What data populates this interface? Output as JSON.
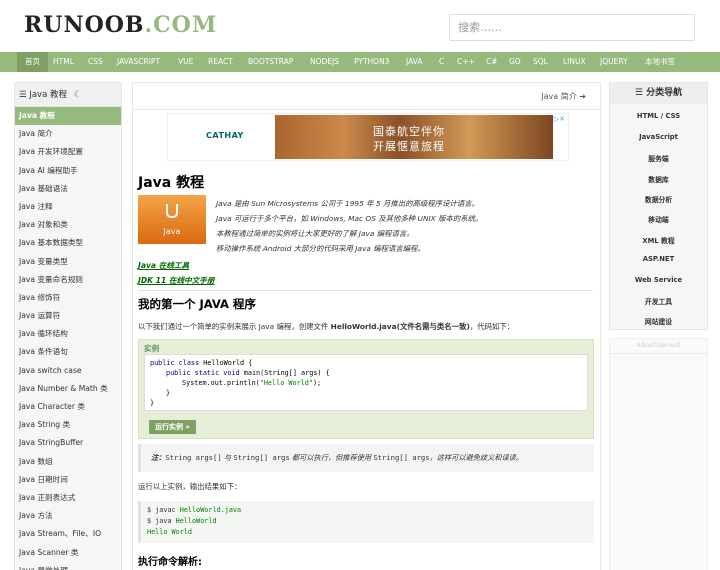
{
  "site": {
    "logo_main": "RUNOOB",
    "logo_suffix": ".COM"
  },
  "search": {
    "placeholder": "搜索……"
  },
  "nav": {
    "items": [
      "首页",
      "HTML",
      "CSS",
      "JAVASCRIPT",
      "VUE",
      "REACT",
      "BOOTSTRAP",
      "NODEJS",
      "PYTHON3",
      "JAVA",
      "C",
      "C++",
      "C#",
      "GO",
      "SQL",
      "LINUX",
      "JQUERY",
      "本地书签"
    ]
  },
  "sidebar": {
    "title": "Java 教程",
    "title_icon": "☰",
    "moon_icon": "☾",
    "items": [
      "Java 教程",
      "Java 简介",
      "Java 开发环境配置",
      "Java AI 编程助手",
      "Java 基础语法",
      "Java 注释",
      "Java 对象和类",
      "Java 基本数据类型",
      "Java 变量类型",
      "Java 变量命名规则",
      "Java 修饰符",
      "Java 运算符",
      "Java 循环结构",
      "Java 条件语句",
      "Java switch case",
      "Java Number & Math 类",
      "Java Character 类",
      "Java String 类",
      "Java StringBuffer",
      "Java 数组",
      "Java 日期时间",
      "Java 正则表达式",
      "Java 方法",
      "Java Stream、File、IO",
      "Java Scanner 类",
      "Java 异常处理"
    ]
  },
  "main": {
    "next_link": "Java 简介",
    "ad": {
      "brand": "CATHAY",
      "text1": "国泰航空伴你",
      "text2": "开展惬意旅程"
    },
    "title": "Java 教程",
    "logo_text": "Java",
    "intro": [
      "Java 是由 Sun Microsystems 公司于 1995 年 5 月推出的高级程序设计语言。",
      "Java 可运行于多个平台，如 Windows, Mac OS 及其他多种 UNIX 版本的系统。",
      "本教程通过简单的实例将让大家更好的了解 Java 编程语言。",
      "移动操作系统 Android 大部分的代码采用 Java 编程语言编程。"
    ],
    "link1": "Java 在线工具",
    "link2": "JDK 11 在线中文手册",
    "h2_first": "我的第一个 JAVA 程序",
    "desc_prefix": "以下我们通过一个简单的实例来展示 Java 编程，创建文件 ",
    "desc_file": "HelloWorld.java(文件名需与类名一致)",
    "desc_suffix": "，代码如下：",
    "example_title": "实例",
    "code": {
      "line1_kw": "public class",
      "line1_rest": " HelloWorld {",
      "line2_kw": "public static void",
      "line2_rest": " main(String[] args) {",
      "line3_pre": "System.out.println(",
      "line3_str": "\"Hello World\"",
      "line3_post": ");",
      "line4": "}",
      "line5": "}"
    },
    "run_button": "运行实例 »",
    "note_label": "注：",
    "note_code1": "String args[]",
    "note_mid": " 与 ",
    "note_code2": "String[] args",
    "note_mid2": " 都可以执行，但推荐使用 ",
    "note_code3": "String[] args",
    "note_end": "，这样可以避免歧义和误读。",
    "run_desc": "运行以上实例，输出结果如下：",
    "term": {
      "l1_prefix": "$ javac ",
      "l1_file": "HelloWorld.java",
      "l2_prefix": "$ java ",
      "l2_file": "HelloWorld",
      "l3": "Hello World"
    },
    "h2_exec": "执行命令解析:"
  },
  "right": {
    "title": "分类导航",
    "title_icon": "☰",
    "items": [
      "HTML / CSS",
      "JavaScript",
      "服务端",
      "数据库",
      "数据分析",
      "移动端",
      "XML 教程",
      "ASP.NET",
      "Web Service",
      "开发工具",
      "网站建设"
    ],
    "ad_label": "Advertisement"
  },
  "colors": {
    "accent": "#96b97d",
    "accent_dark": "#7fa063",
    "link_green": "#006600"
  }
}
